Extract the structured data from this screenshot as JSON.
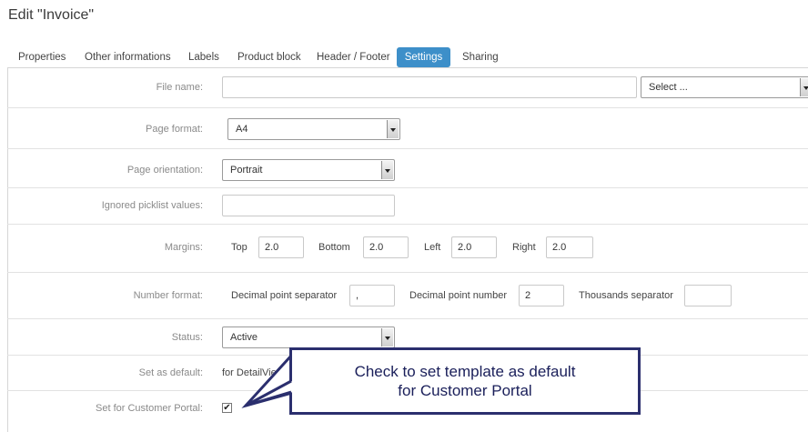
{
  "page": {
    "title": "Edit \"Invoice\""
  },
  "tabs": [
    {
      "label": "Properties",
      "active": false
    },
    {
      "label": "Other informations",
      "active": false
    },
    {
      "label": "Labels",
      "active": false
    },
    {
      "label": "Product block",
      "active": false
    },
    {
      "label": "Header / Footer",
      "active": false
    },
    {
      "label": "Settings",
      "active": true
    },
    {
      "label": "Sharing",
      "active": false
    }
  ],
  "form": {
    "file_name": {
      "label": "File name:",
      "value": "",
      "select_value": "Select ..."
    },
    "page_format": {
      "label": "Page format:",
      "value": "A4"
    },
    "page_orientation": {
      "label": "Page orientation:",
      "value": "Portrait"
    },
    "ignored_picklist": {
      "label": "Ignored picklist values:",
      "value": ""
    },
    "margins": {
      "label": "Margins:",
      "top_label": "Top",
      "top_value": "2.0",
      "bottom_label": "Bottom",
      "bottom_value": "2.0",
      "left_label": "Left",
      "left_value": "2.0",
      "right_label": "Right",
      "right_value": "2.0"
    },
    "number_format": {
      "label": "Number format:",
      "decimal_sep_label": "Decimal point separator",
      "decimal_sep_value": ",",
      "decimal_num_label": "Decimal point number",
      "decimal_num_value": "2",
      "thousands_label": "Thousands separator",
      "thousands_value": ""
    },
    "status": {
      "label": "Status:",
      "value": "Active"
    },
    "set_default": {
      "label": "Set as default:",
      "value": "for DetailView"
    },
    "customer_portal": {
      "label": "Set for Customer Portal:",
      "checked": true,
      "check_glyph": "✔"
    }
  },
  "callout": {
    "line1": "Check to set template as default",
    "line2": "for Customer Portal"
  },
  "colors": {
    "tab_active": "#3d8fc9",
    "callout_border": "#2b2f6e"
  }
}
